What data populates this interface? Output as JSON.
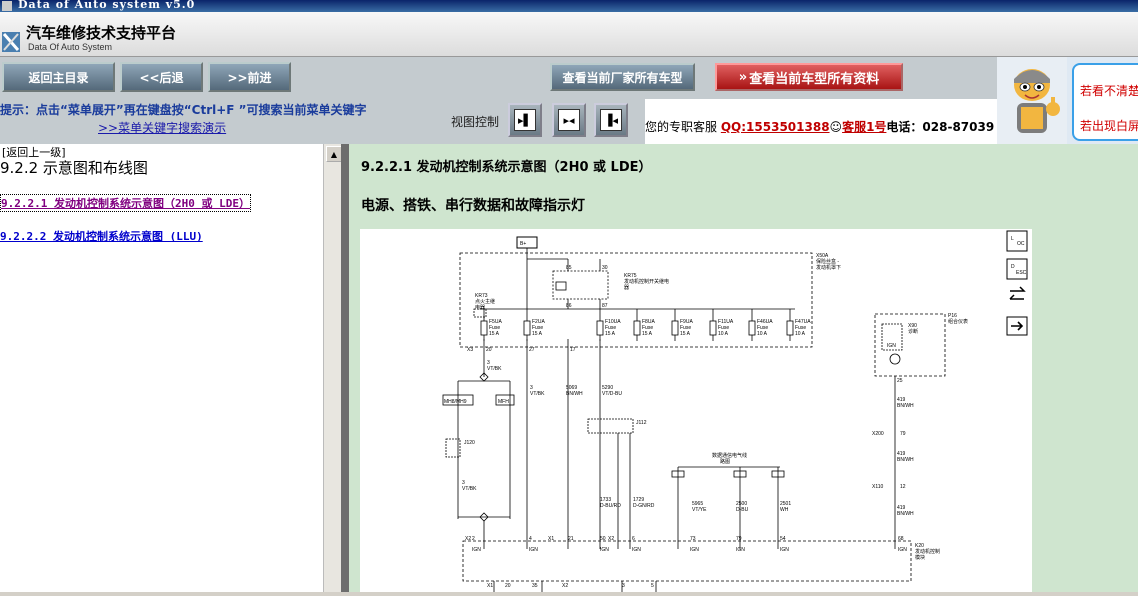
{
  "window": {
    "title": "Data of Auto system v5.0"
  },
  "app": {
    "name": "汽车维修技术支持平台",
    "subtitle": "Data Of Auto System"
  },
  "nav": {
    "home": "返回主目录",
    "back": "<<后退",
    "forward": ">>前进"
  },
  "buttons": {
    "factory_models": "查看当前厂家所有车型",
    "all_data": "查看当前车型所有资料"
  },
  "hint": {
    "text": "提示：点击“菜单展开”再在键盘按“Ctrl+F ”可搜索当前菜单关键字",
    "demo_link": ">>菜单关键字搜索演示"
  },
  "view_control": {
    "label": "视图控制"
  },
  "service": {
    "label": "您的专职客服",
    "qq": "QQ:1553501388",
    "kf": "客服1号",
    "phone": "电话：028-87039"
  },
  "right_notice": {
    "line1": "若看不清楚",
    "line2": "若出现白屏"
  },
  "left": {
    "back_link": "返回上一级",
    "section_title": "9.2.2 示意图和布线图",
    "items": [
      {
        "label": "9.2.2.1 发动机控制系统示意图（2H0 或 LDE）"
      },
      {
        "label": "9.2.2.2 发动机控制系统示意图 (LLU)"
      }
    ]
  },
  "doc": {
    "title": "9.2.2.1 发动机控制系统示意图（2H0 或 LDE）",
    "subtitle": "电源、搭铁、串行数据和故障指示灯"
  },
  "diagram": {
    "side_icons": [
      "loc-icon",
      "desc-icon",
      "swap-icon",
      "arrow-icon"
    ],
    "labels": {
      "bplus": "B+",
      "x50a": "X50A",
      "x50a_desc1": "保险丝盒 -",
      "x50a_desc2": "发动机罩下",
      "kr75": "KR75",
      "kr75_desc1": "发动机控制开关继电",
      "kr75_desc2": "器",
      "kr73": "KR73",
      "kr73_desc1": "点火主继",
      "kr73_desc2": "电器",
      "p16": "P16",
      "p16_desc": "组合仪表",
      "x90": "X90",
      "x90_desc": "诊断",
      "ign": "IGN",
      "j112": "J112",
      "j120": "J120",
      "mh8": "MH8/MH9",
      "mfh": "MFH",
      "serial": "数据通信电气线",
      "serial2": "路图",
      "k20": "K20",
      "k20_desc1": "发动机控制",
      "k20_desc2": "模块",
      "x3": "X3",
      "x200": "X200",
      "x110": "X110",
      "x1": "X1",
      "x2": "X2"
    },
    "fuses": [
      {
        "name": "F5UA",
        "rating": "15 A"
      },
      {
        "name": "F2UA",
        "rating": "15 A"
      },
      {
        "name": "F10UA",
        "rating": "15 A"
      },
      {
        "name": "F8UA",
        "rating": "15 A"
      },
      {
        "name": "F9UA",
        "rating": "15 A"
      },
      {
        "name": "F11UA",
        "rating": "10 A"
      },
      {
        "name": "F46UA",
        "rating": "10 A"
      },
      {
        "name": "F47UA",
        "rating": "10 A"
      }
    ],
    "wires": [
      {
        "num": "3",
        "color": "VT/BK"
      },
      {
        "num": "5069",
        "color": "BN/WH"
      },
      {
        "num": "5290",
        "color": "VT/D-BU"
      },
      {
        "num": "419",
        "color": "BN/WH"
      },
      {
        "num": "1733",
        "color": "D-BU/RD"
      },
      {
        "num": "1729",
        "color": "D-GN/RD"
      },
      {
        "num": "5965",
        "color": "VT/YE"
      },
      {
        "num": "2500",
        "color": "D-BU"
      },
      {
        "num": "2501",
        "color": "WH"
      }
    ],
    "pins": {
      "x3_a": "20",
      "x3_b": "27",
      "x3_c": "17",
      "relay_85": "85",
      "relay_30": "30",
      "relay_86": "86",
      "relay_87": "87",
      "p16_25": "25",
      "x200_79": "79",
      "x110_12": "12",
      "k20_2": "2",
      "k20_4": "4",
      "k20_21": "21",
      "k20_50": "50",
      "k20_6": "6",
      "k20_73": "73",
      "k20_79": "79",
      "k20_54": "54",
      "k20_68": "68",
      "b_20": "20",
      "b_35": "35",
      "b_3": "3",
      "b_5": "5"
    }
  }
}
